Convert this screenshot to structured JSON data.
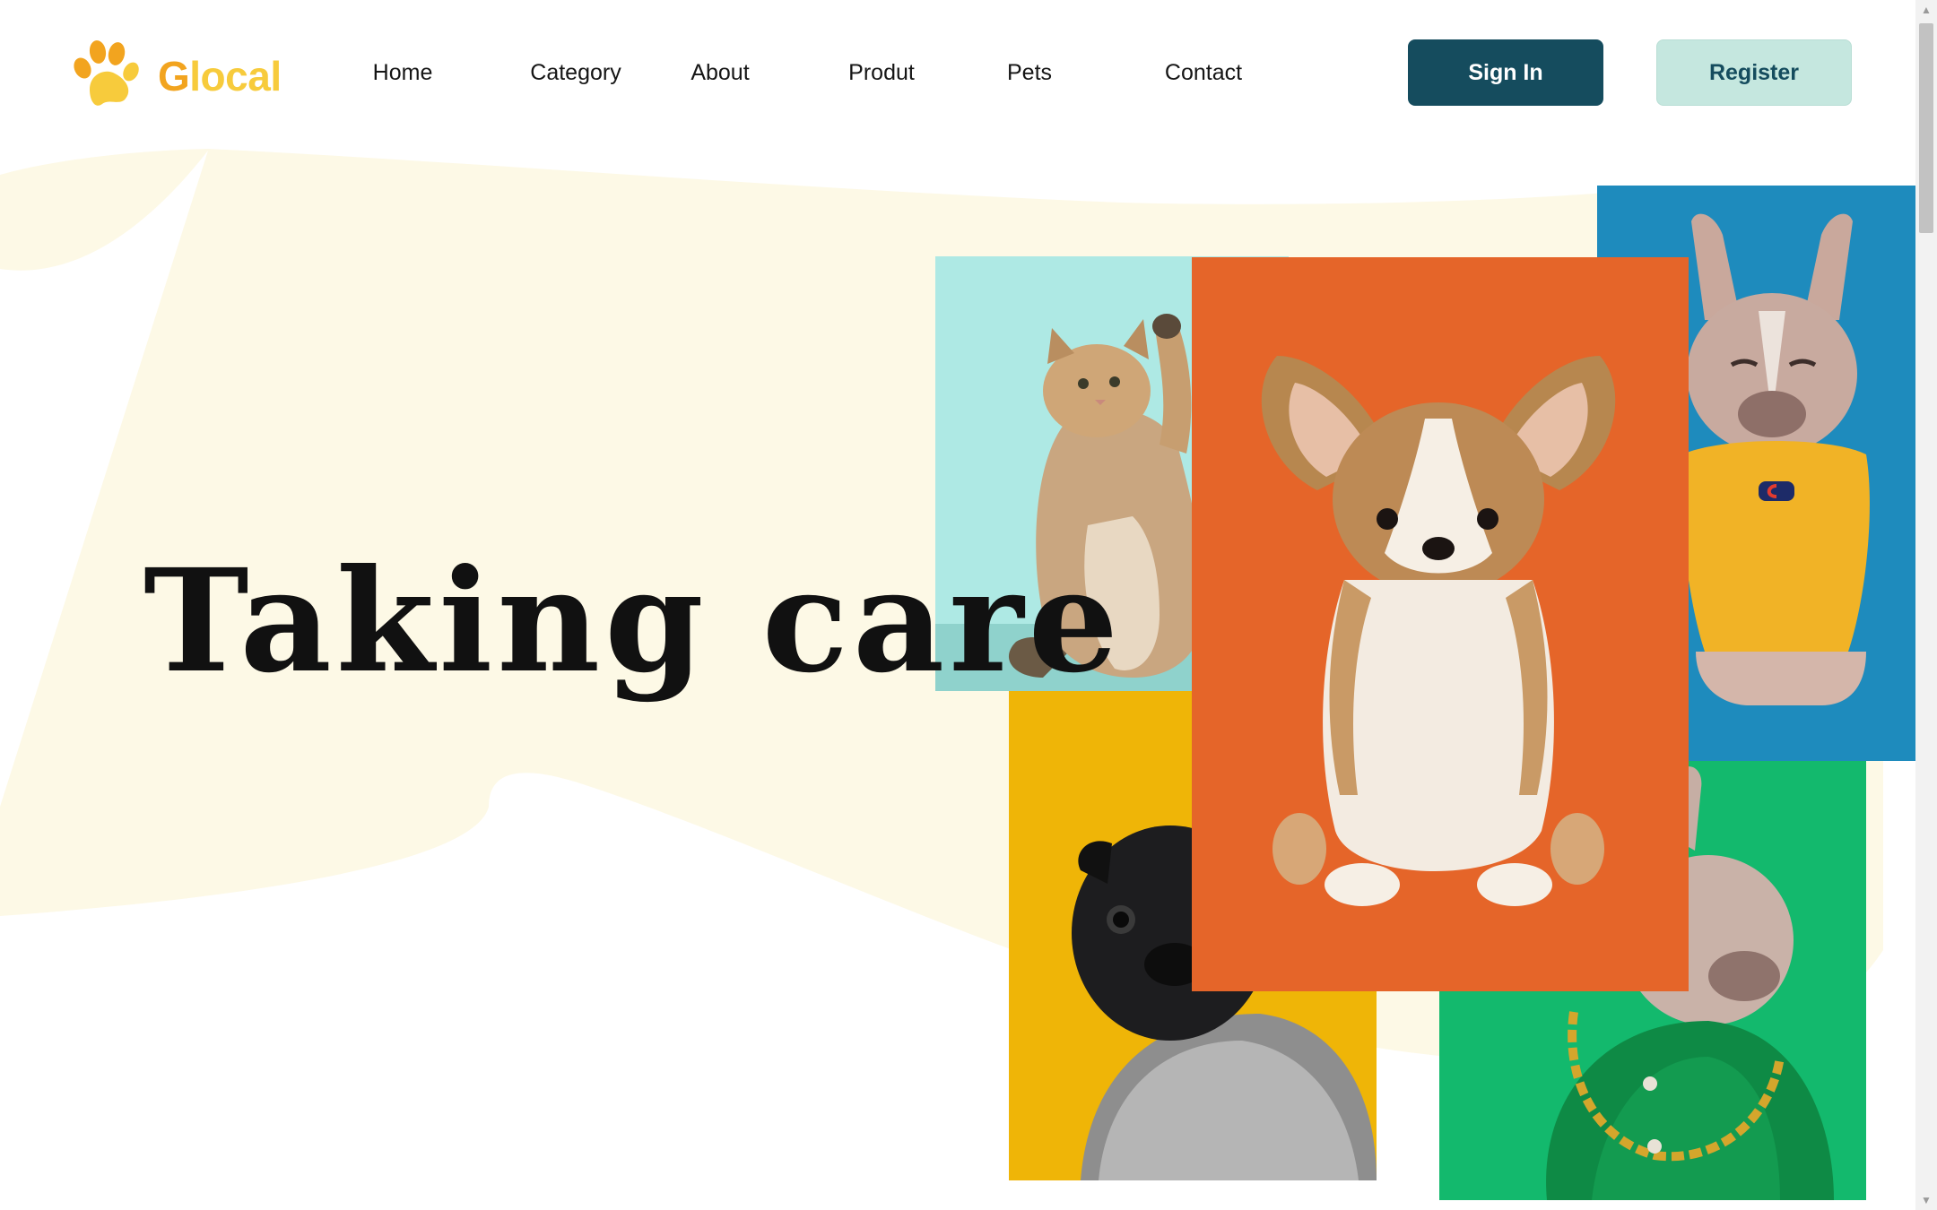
{
  "brand": {
    "name_first_letter": "G",
    "name_rest": "local",
    "logo_icon": "paw-icon",
    "colors": {
      "primary": "#f2a41f",
      "secondary": "#f7cb3c"
    }
  },
  "nav": {
    "items": [
      {
        "label": "Home"
      },
      {
        "label": "Category"
      },
      {
        "label": "About"
      },
      {
        "label": "Produt"
      },
      {
        "label": "Pets"
      },
      {
        "label": "Contact"
      }
    ]
  },
  "auth": {
    "sign_in_label": "Sign In",
    "register_label": "Register",
    "colors": {
      "sign_in_bg": "#154c5e",
      "register_bg": "#c5e7df"
    }
  },
  "hero": {
    "headline": "Taking care",
    "background_color": "#fdf9e6",
    "photos": [
      {
        "subject": "kitten",
        "background": "#aee9e4"
      },
      {
        "subject": "corgi puppy",
        "background": "#e56529"
      },
      {
        "subject": "french bulldog in yellow hoodie",
        "background": "#1e8bbd"
      },
      {
        "subject": "pug in knit sweater",
        "background": "#efb507"
      },
      {
        "subject": "french bulldog with gold chain",
        "background": "#13b96d"
      }
    ]
  }
}
